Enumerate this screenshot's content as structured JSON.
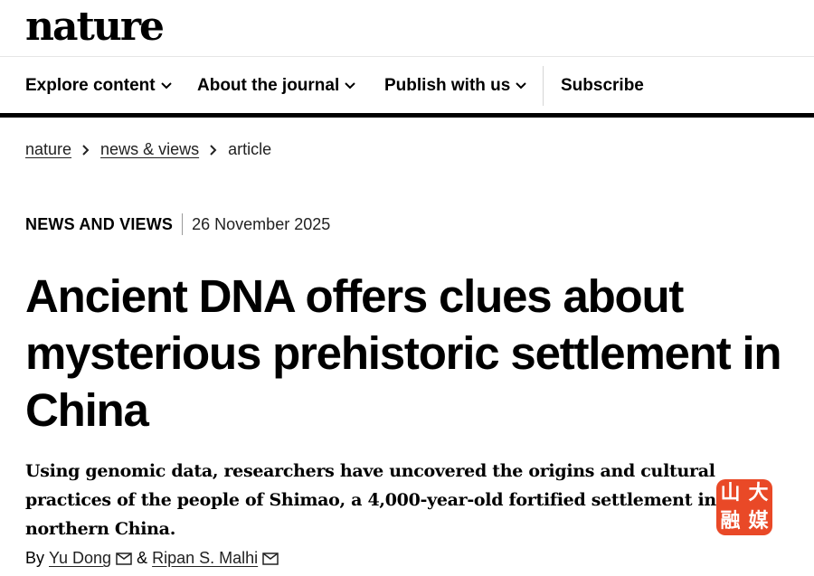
{
  "site": {
    "logo": "nature"
  },
  "nav": {
    "items": [
      {
        "label": "Explore content"
      },
      {
        "label": "About the journal"
      },
      {
        "label": "Publish with us"
      }
    ],
    "subscribe": "Subscribe"
  },
  "breadcrumb": [
    {
      "label": "nature"
    },
    {
      "label": "news & views"
    },
    {
      "label": "article"
    }
  ],
  "article": {
    "type": "NEWS AND VIEWS",
    "date": "26 November 2025",
    "title": "Ancient DNA offers clues about mysterious prehistoric settlement in China",
    "standfirst": "Using genomic data, researchers have uncovered the origins and cultural practices of the people of Shimao, a 4,000-year-old fortified settlement in northern China.",
    "by": "By",
    "authors": [
      "Yu Dong",
      "Ripan S. Malhi"
    ],
    "author_joiner": "&"
  },
  "watermark": {
    "chars": [
      "山",
      "大",
      "融",
      "媒"
    ],
    "color": "#e8401c"
  }
}
